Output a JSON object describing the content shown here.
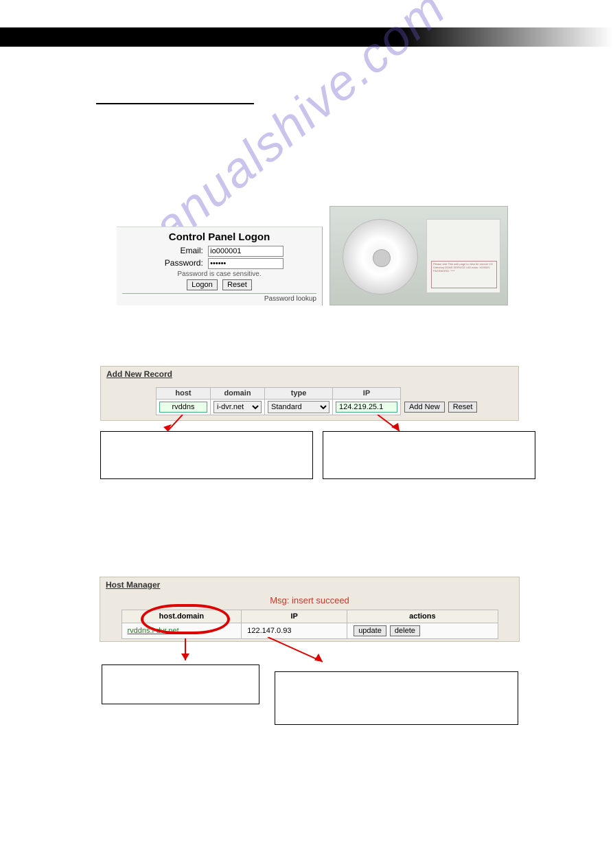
{
  "link": "",
  "logon": {
    "title": "Control Panel Logon",
    "email_label": "Email:",
    "email_value": "io000001",
    "password_label": "Password:",
    "password_value": "••••••",
    "note": "Password is case sensitive.",
    "logon_btn": "Logon",
    "reset_btn": "Reset",
    "foot": "Password lookup"
  },
  "sleeve_label": "Please visit\nThis web page to view\nhe remote CD Directory\nDDNS SERVICE\nUID main: 1020001\nPASSWORD: ****",
  "add_record": {
    "title": "Add New Record",
    "headers": {
      "host": "host",
      "domain": "domain",
      "type": "type",
      "ip": "IP"
    },
    "host_value": "rvddns",
    "domain_value": "i-dvr.net",
    "type_value": "Standard",
    "ip_value": "124.219.25.1",
    "add_btn": "Add New",
    "reset_btn": "Reset"
  },
  "host_mgr": {
    "title": "Host Manager",
    "msg": "Msg: insert succeed",
    "headers": {
      "hd": "host.domain",
      "ip": "IP",
      "actions": "actions"
    },
    "hd_value": "rvddns.i-dvr.net",
    "ip_value": "122.147.0.93",
    "update_btn": "update",
    "delete_btn": "delete"
  },
  "chart_data": {
    "type": "table",
    "tables": [
      {
        "name": "Add New Record",
        "columns": [
          "host",
          "domain",
          "type",
          "IP"
        ],
        "rows": [
          [
            "rvddns",
            "i-dvr.net",
            "Standard",
            "124.219.25.1"
          ]
        ],
        "actions": [
          "Add New",
          "Reset"
        ]
      },
      {
        "name": "Host Manager",
        "message": "Msg: insert succeed",
        "columns": [
          "host.domain",
          "IP",
          "actions"
        ],
        "rows": [
          [
            "rvddns.i-dvr.net",
            "122.147.0.93",
            "update | delete"
          ]
        ]
      }
    ]
  }
}
